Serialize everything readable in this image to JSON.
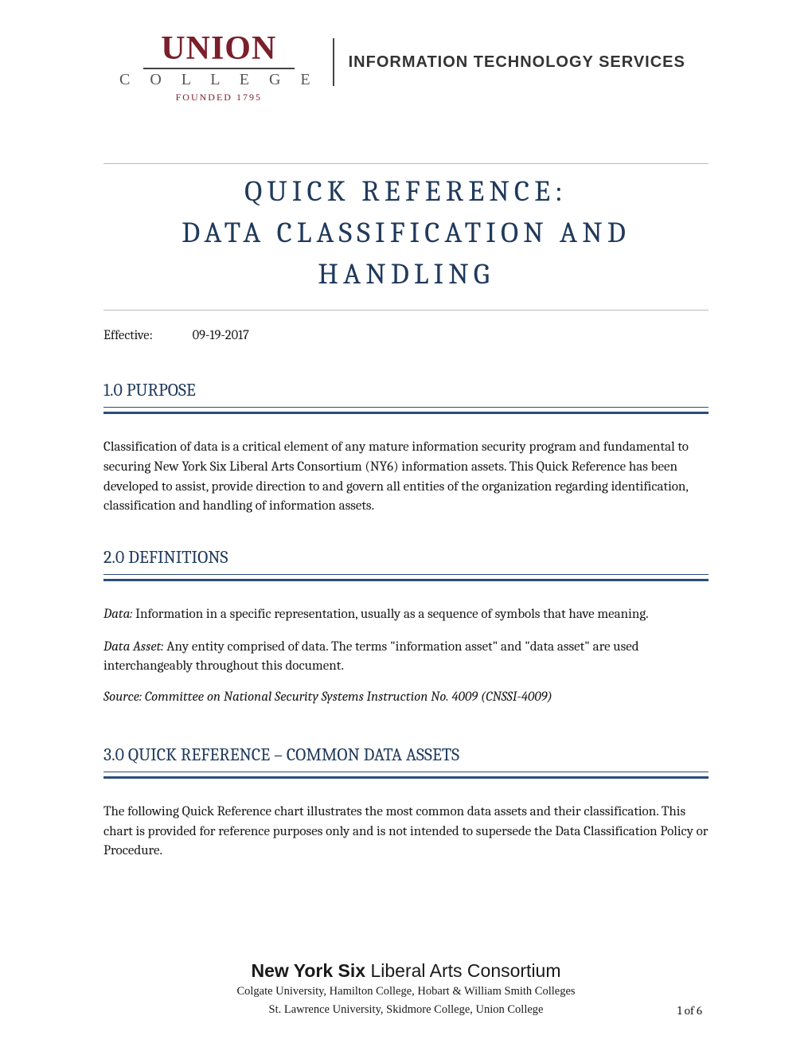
{
  "header": {
    "logo_union": "UNION",
    "logo_college": "C O L L E G E",
    "logo_founded": "FOUNDED 1795",
    "its_label": "INFORMATION TECHNOLOGY SERVICES"
  },
  "title": {
    "line1": "QUICK REFERENCE:",
    "line2": "DATA CLASSIFICATION AND",
    "line3": "HANDLING"
  },
  "effective": {
    "label": "Effective:",
    "date": "09-19-2017"
  },
  "sections": {
    "purpose": {
      "heading": "1.0 PURPOSE",
      "body": "Classification of data is a critical element of any mature information security program and fundamental to securing New York Six Liberal Arts Consortium (NY6) information assets.  This Quick Reference has been developed to assist, provide direction to and govern all entities of the organization regarding identification, classification and handling of information assets."
    },
    "definitions": {
      "heading": "2.0 DEFINITIONS",
      "data_term": "Data:",
      "data_def": " Information in a specific representation, usually as a sequence of symbols that have meaning.",
      "asset_term": "Data Asset:",
      "asset_def": " Any entity comprised of data. The terms \"information asset\" and \"data asset\" are used interchangeably throughout this document.",
      "source": "Source: Committee on National Security Systems Instruction No. 4009 (CNSSI-4009)"
    },
    "quickref": {
      "heading": "3.0 QUICK REFERENCE – COMMON DATA ASSETS",
      "body": "The following Quick Reference chart illustrates the most common data assets and their classification. This chart is provided for reference purposes only and is not intended to supersede the Data Classification Policy or Procedure."
    }
  },
  "footer": {
    "title_bold": "New York Six",
    "title_rest": " Liberal Arts Consortium",
    "colleges_line1": "Colgate University, Hamilton College, Hobart & William Smith Colleges",
    "colleges_line2": "St. Lawrence University, Skidmore College, Union College"
  },
  "page_number": "1 of 6"
}
